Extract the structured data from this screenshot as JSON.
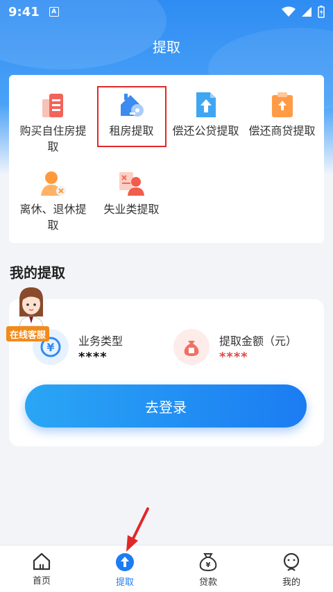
{
  "status_bar": {
    "time": "9:41",
    "notification_letter": "A"
  },
  "header": {
    "title": "提取"
  },
  "services": [
    {
      "label": "购买自住房提取",
      "icon": "building-icon"
    },
    {
      "label": "租房提取",
      "icon": "house-key-icon"
    },
    {
      "label": "偿还公贷提取",
      "icon": "document-upload-icon"
    },
    {
      "label": "偿还商贷提取",
      "icon": "clipboard-upload-icon"
    },
    {
      "label": "离休、退休提取",
      "icon": "retired-person-icon"
    },
    {
      "label": "失业类提取",
      "icon": "unemployed-person-icon"
    }
  ],
  "my_withdrawal": {
    "title": "我的提取",
    "business_type_label": "业务类型",
    "business_type_value": "****",
    "amount_label": "提取金额（元）",
    "amount_value": "****",
    "login_button": "去登录"
  },
  "customer_service": {
    "badge": "在线客服"
  },
  "tabs": [
    {
      "label": "首页",
      "icon": "home-icon"
    },
    {
      "label": "提取",
      "icon": "upload-arrow-icon",
      "active": true
    },
    {
      "label": "贷款",
      "icon": "money-bag-icon"
    },
    {
      "label": "我的",
      "icon": "user-icon"
    }
  ],
  "colors": {
    "primary": "#1d7cf2",
    "highlight_border": "#e02828",
    "amount_red": "#e04848",
    "badge_orange": "#f28a1a"
  }
}
